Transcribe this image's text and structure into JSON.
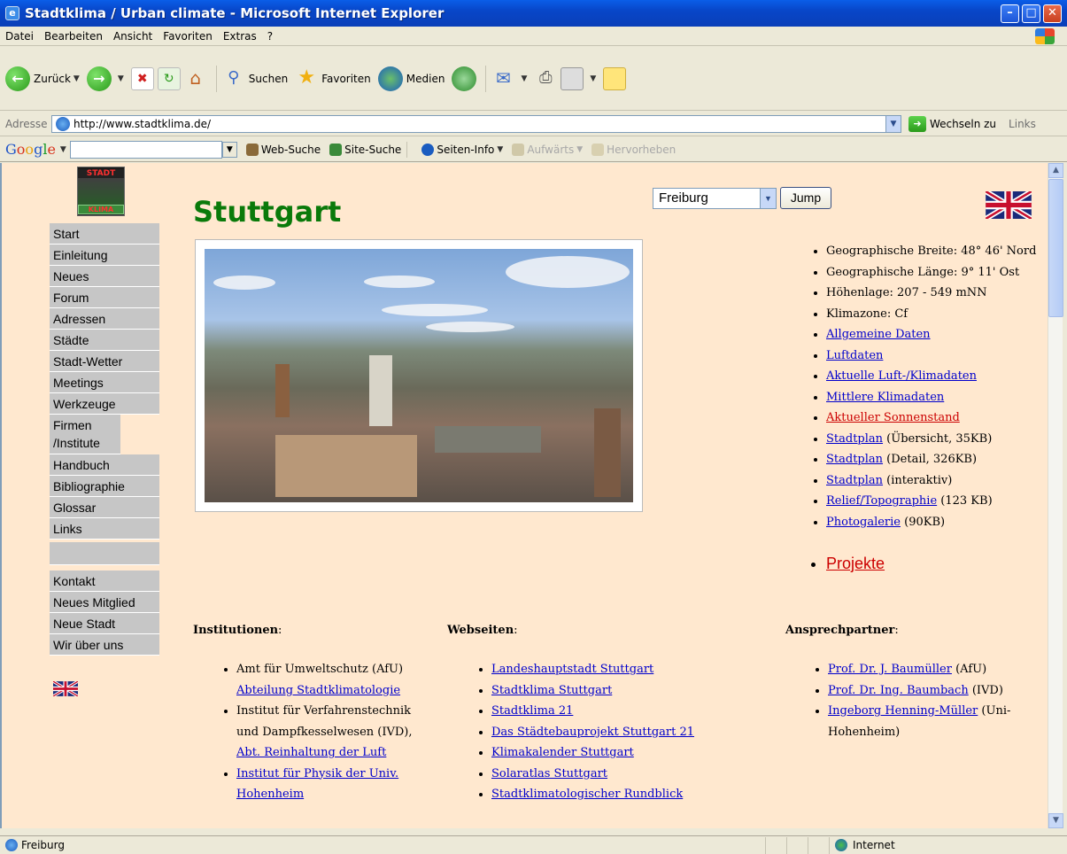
{
  "window": {
    "title": "Stadtklima / Urban climate - Microsoft Internet Explorer"
  },
  "menu": [
    "Datei",
    "Bearbeiten",
    "Ansicht",
    "Favoriten",
    "Extras",
    "?"
  ],
  "toolbar": {
    "back": "Zurück",
    "search": "Suchen",
    "favorites": "Favoriten",
    "media": "Medien"
  },
  "address": {
    "label": "Adresse",
    "url": "http://www.stadtklima.de/",
    "go": "Wechseln zu",
    "links": "Links"
  },
  "google": {
    "logo": "Google",
    "web_search": "Web-Suche",
    "site_search": "Site-Suche",
    "page_info": "Seiten-Info",
    "up": "Aufwärts",
    "highlight": "Hervorheben"
  },
  "nav": {
    "logo_top": "STADT",
    "logo_bottom": "KLIMA",
    "items": [
      "Start",
      "Einleitung",
      "Neues",
      "Forum",
      "Adressen",
      "Städte",
      "Stadt-Wetter",
      "Meetings",
      "Werkzeuge",
      "Firmen /Institute",
      "Handbuch",
      "Bibliographie",
      "Glossar",
      "Links"
    ],
    "items2": [
      "Kontakt",
      "Neues Mitglied",
      "Neue Stadt",
      "Wir über uns"
    ]
  },
  "main": {
    "title": "Stuttgart",
    "jump_select": "Freiburg",
    "jump_button": "Jump",
    "info": [
      {
        "text": "Geographische Breite: 48° 46' Nord"
      },
      {
        "text": "Geographische Länge: 9° 11' Ost"
      },
      {
        "text": "Höhenlage: 207 - 549 mNN"
      },
      {
        "text": "Klimazone: Cf"
      }
    ],
    "links": [
      {
        "link": "Allgemeine Daten",
        "rest": ""
      },
      {
        "link": "Luftdaten",
        "rest": ""
      },
      {
        "link": "Aktuelle Luft-/Klimadaten",
        "rest": ""
      },
      {
        "link": "Mittlere Klimadaten",
        "rest": ""
      },
      {
        "link": "Aktueller Sonnenstand",
        "rest": ""
      },
      {
        "link": "Stadtplan",
        "rest": " (Übersicht, 35KB)"
      },
      {
        "link": "Stadtplan",
        "rest": " (Detail, 326KB)"
      },
      {
        "link": "Stadtplan",
        "rest": " (interaktiv)"
      },
      {
        "link": "Relief/Topographie",
        "rest": " (123 KB)"
      },
      {
        "link": "Photogalerie",
        "rest": " (90KB)"
      }
    ],
    "projekte": "Projekte"
  },
  "columns": {
    "institutionen": {
      "head": "Institutionen",
      "items": [
        {
          "plain": "Amt für Umweltschutz (AfU)",
          "link": "Abteilung Stadtklimatologie"
        },
        {
          "plain": "Institut für Verfahrenstechnik und Dampfkesselwesen (IVD),",
          "link": "Abt. Reinhaltung der Luft"
        },
        {
          "plain": "",
          "link": "Institut für Physik der Univ. Hohenheim"
        }
      ]
    },
    "webseiten": {
      "head": "Webseiten",
      "items": [
        "Landeshauptstadt Stuttgart",
        "Stadtklima Stuttgart",
        "Stadtklima 21",
        "Das Städtebauprojekt Stuttgart 21",
        "Klimakalender Stuttgart",
        "Solaratlas Stuttgart",
        "Stadtklimatologischer Rundblick"
      ]
    },
    "ansprechpartner": {
      "head": "Ansprechpartner",
      "items": [
        {
          "link": "Prof. Dr. J. Baumüller",
          "rest": " (AfU)"
        },
        {
          "link": "Prof. Dr. Ing. Baumbach",
          "rest": " (IVD)"
        },
        {
          "link": "Ingeborg Henning-Müller",
          "rest": " (Uni-Hohenheim)"
        }
      ]
    }
  },
  "status": {
    "text": "Freiburg",
    "zone": "Internet"
  },
  "colors": {
    "page_bg": "#ffe8cf",
    "title_green": "#0a7a0a",
    "nav_gray": "#c6c6c6",
    "link_blue": "#0000cc",
    "link_red": "#cc0000"
  }
}
